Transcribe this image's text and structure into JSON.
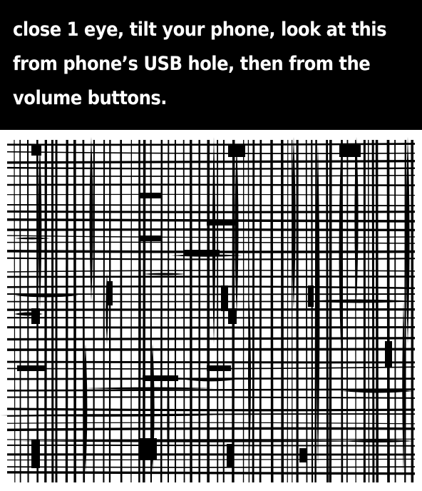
{
  "caption": {
    "text": "close 1 eye, tilt your phone, look at this\nfrom phone’s USB hole, then from the\nvolume buttons."
  },
  "colors": {
    "caption_background": "#000000",
    "caption_text": "#ffffff",
    "illusion_background": "#ffffff",
    "illusion_lines": "#000000"
  }
}
